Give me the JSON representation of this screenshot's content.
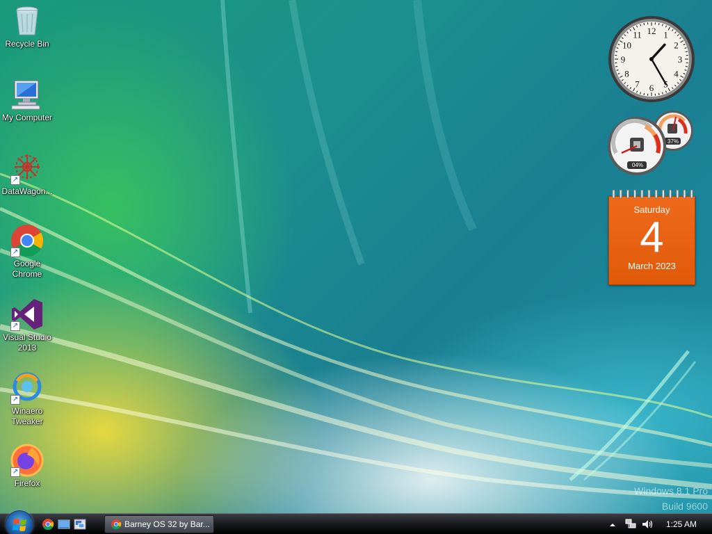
{
  "desktop": {
    "icons": [
      {
        "label": "Recycle Bin"
      },
      {
        "label": "My Computer"
      },
      {
        "label": "DataWagon..."
      },
      {
        "label": "Google\nChrome"
      },
      {
        "label": "Visual Studio\n2013"
      },
      {
        "label": "Winaero\nTweaker"
      },
      {
        "label": "Firefox"
      }
    ],
    "watermark": {
      "line1": "Windows 8.1 Pro",
      "line2": "Build 9600"
    }
  },
  "gadgets": {
    "clock": {
      "hour": 1,
      "minute": 25,
      "numerals": [
        "12",
        "1",
        "2",
        "3",
        "4",
        "5",
        "6",
        "7",
        "8",
        "9",
        "10",
        "11"
      ]
    },
    "cpu_meter": {
      "cpu": "04%",
      "memory": "37%"
    },
    "calendar": {
      "weekday": "Saturday",
      "day": "4",
      "month_year": "March 2023"
    }
  },
  "taskbar": {
    "task_button_label": "Barney OS 32 by Bar...",
    "clock_time": "1:25 AM"
  },
  "colors": {
    "calendar": "#e9651a",
    "taskbar": "#1b1d21"
  }
}
